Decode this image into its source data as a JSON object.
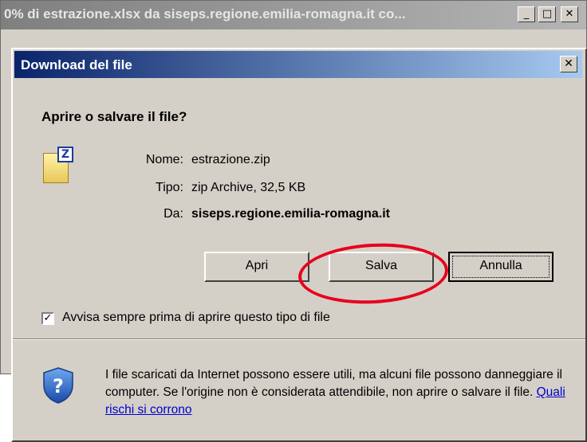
{
  "background_window": {
    "title": "0% di estrazione.xlsx da siseps.regione.emilia-romagna.it co..."
  },
  "dialog": {
    "title": "Download del file",
    "question": "Aprire o salvare il file?",
    "file_info": {
      "name_label": "Nome:",
      "name_value": "estrazione.zip",
      "type_label": "Tipo:",
      "type_value": "zip Archive, 32,5 KB",
      "from_label": "Da:",
      "from_value": "siseps.regione.emilia-romagna.it"
    },
    "buttons": {
      "open": "Apri",
      "save": "Salva",
      "cancel": "Annulla"
    },
    "checkbox": {
      "label": "Avvisa sempre prima di aprire questo tipo di file",
      "checked": true
    },
    "warning": {
      "text": "I file scaricati da Internet possono essere utili, ma alcuni file possono danneggiare il computer. Se l'origine non è considerata attendibile, non aprire o salvare il file.",
      "link": "Quali rischi si corrono"
    }
  },
  "annotation": {
    "highlight_color": "#e8001c"
  }
}
